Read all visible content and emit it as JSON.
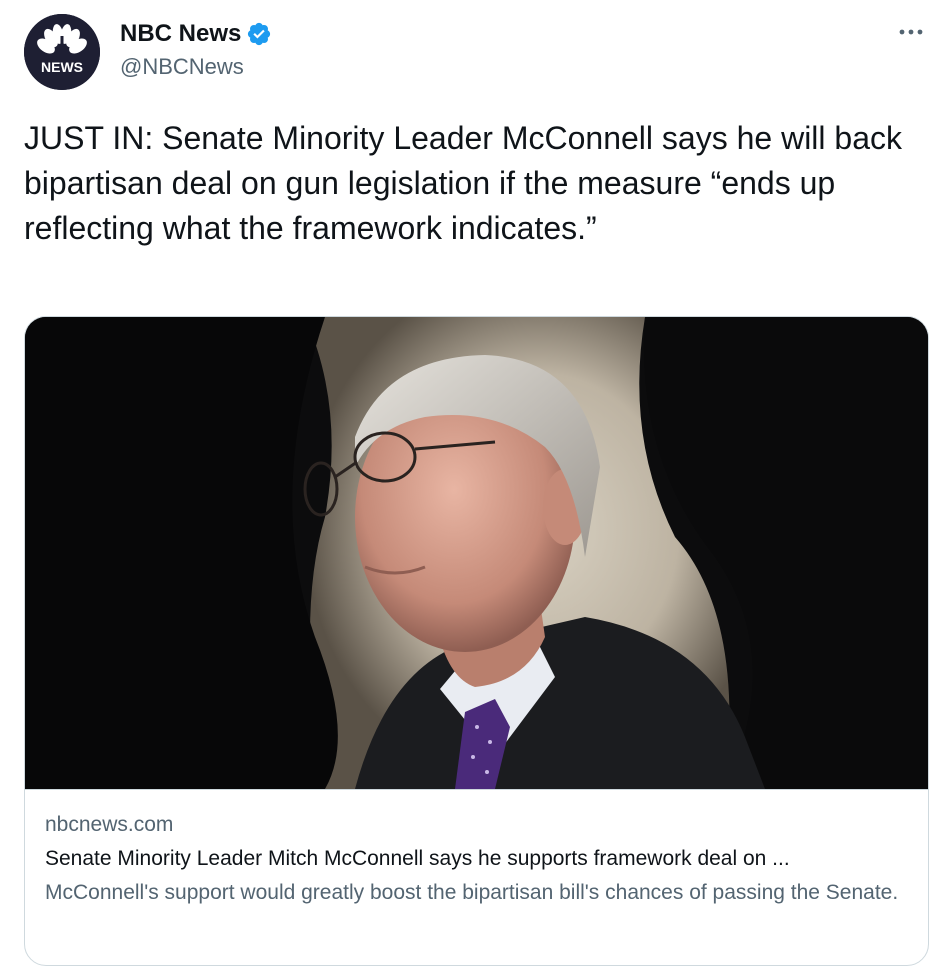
{
  "author": {
    "display_name": "NBC News",
    "handle": "@NBCNews",
    "avatar_text": "NEWS",
    "verified": true
  },
  "tweet": {
    "text": "JUST IN: Senate Minority Leader McConnell says he will back bipartisan deal on gun legislation if the measure “ends up reflecting what the framework indicates.”"
  },
  "link_card": {
    "domain": "nbcnews.com",
    "title": "Senate Minority Leader Mitch McConnell says he supports framework deal on ...",
    "description": "McConnell's support would greatly boost the bipartisan bill's chances of passing the Senate."
  },
  "icons": {
    "avatar": "nbc-peacock-logo",
    "verified": "verified-badge-icon",
    "more": "more-options-icon"
  },
  "colors": {
    "verified_blue": "#1d9bf0",
    "text_primary": "#0f1419",
    "text_secondary": "#536471",
    "avatar_bg": "#1e1f33"
  }
}
